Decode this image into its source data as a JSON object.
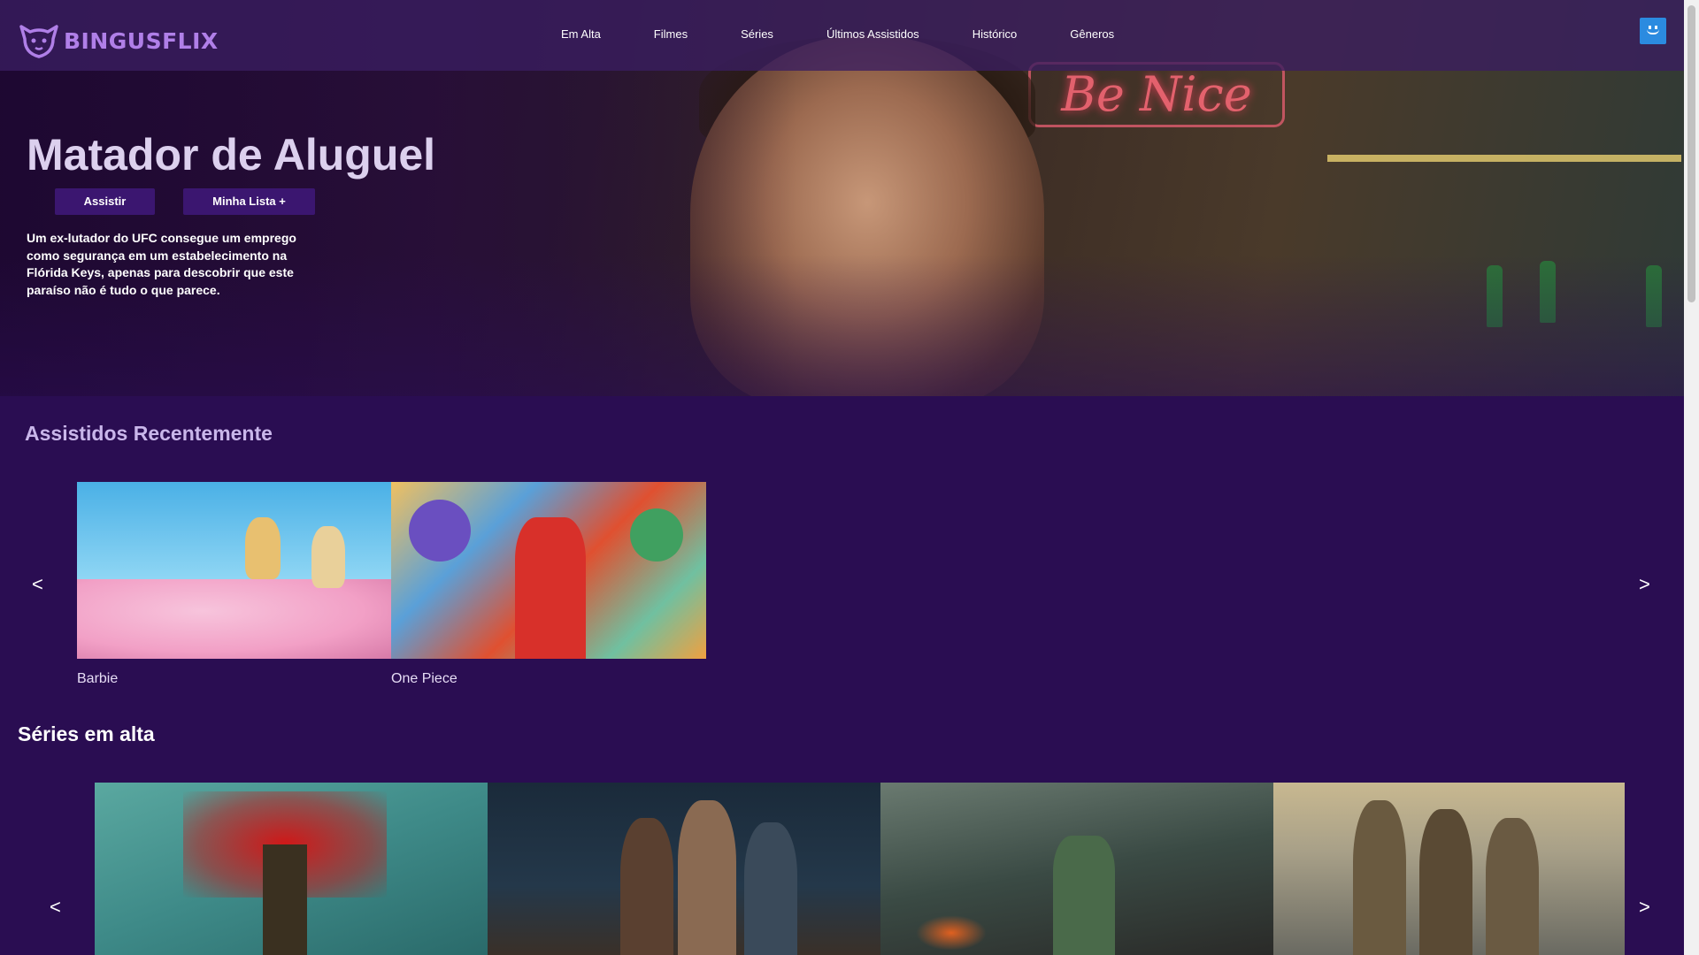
{
  "header": {
    "logo_text": "BINGUSFLIX",
    "nav": [
      "Em Alta",
      "Filmes",
      "Séries",
      "Últimos Assistidos",
      "Histórico",
      "Gêneros"
    ]
  },
  "hero": {
    "title": "Matador de Aluguel",
    "play_label": "Assistir",
    "mylist_label": "Minha Lista +",
    "description": "Um ex-lutador do UFC consegue um emprego como segurança em um estabelecimento na Flórida Keys, apenas para descobrir que este paraíso não é tudo o que parece.",
    "neon_text": "Be Nice"
  },
  "recent": {
    "title": "Assistidos Recentemente",
    "prev": "<",
    "next": ">",
    "items": [
      {
        "label": "Barbie"
      },
      {
        "label": "One Piece"
      }
    ]
  },
  "trending": {
    "title": "Séries em alta",
    "prev": "<",
    "next": ">"
  },
  "colors": {
    "background": "#2a0d52",
    "header": "#3a1e60",
    "button": "#3b1670",
    "logo": "#b07fe8",
    "avatar": "#2b8be0"
  }
}
